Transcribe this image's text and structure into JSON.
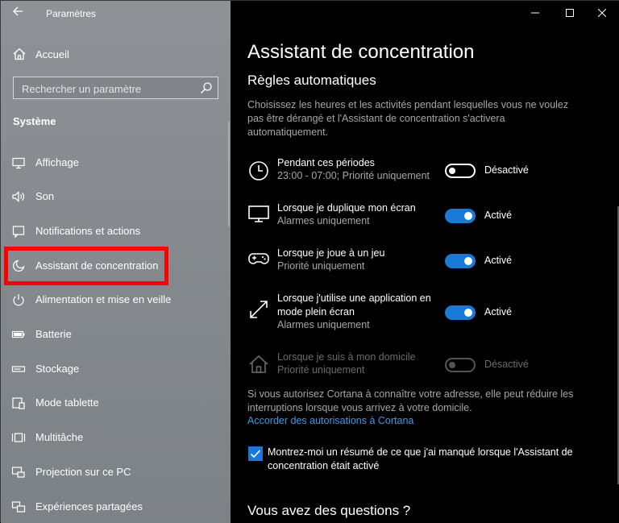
{
  "window": {
    "app_title": "Paramètres"
  },
  "sidebar": {
    "home_label": "Accueil",
    "search_placeholder": "Rechercher un paramètre",
    "section_title": "Système",
    "items": [
      {
        "label": "Affichage",
        "icon": "monitor-icon"
      },
      {
        "label": "Son",
        "icon": "speaker-icon"
      },
      {
        "label": "Notifications et actions",
        "icon": "notification-icon"
      },
      {
        "label": "Assistant de concentration",
        "icon": "moon-icon"
      },
      {
        "label": "Alimentation et mise en veille",
        "icon": "power-icon"
      },
      {
        "label": "Batterie",
        "icon": "battery-icon"
      },
      {
        "label": "Stockage",
        "icon": "storage-icon"
      },
      {
        "label": "Mode tablette",
        "icon": "tablet-icon"
      },
      {
        "label": "Multitâche",
        "icon": "multitask-icon"
      },
      {
        "label": "Projection sur ce PC",
        "icon": "projection-icon"
      },
      {
        "label": "Expériences partagées",
        "icon": "shared-icon"
      }
    ],
    "selected_index": 3
  },
  "main": {
    "title": "Assistant de concentration",
    "subheading": "Règles automatiques",
    "description": "Choisissez les heures et les activités pendant lesquelles vous ne voulez pas être dérangé et l'Assistant de concentration s'activera automatiquement.",
    "rules": [
      {
        "title": "Pendant ces périodes",
        "subtitle": "23:00 - 07:00; Priorité uniquement",
        "state": "Désactivé",
        "on": false,
        "enabled": true,
        "icon": "clock-icon"
      },
      {
        "title": "Lorsque je duplique mon écran",
        "subtitle": "Alarmes uniquement",
        "state": "Activé",
        "on": true,
        "enabled": true,
        "icon": "monitor-icon"
      },
      {
        "title": "Lorsque je joue à un jeu",
        "subtitle": "Priorité uniquement",
        "state": "Activé",
        "on": true,
        "enabled": true,
        "icon": "gamepad-icon"
      },
      {
        "title": "Lorsque j'utilise une application en mode plein écran",
        "subtitle": "Alarmes uniquement",
        "state": "Activé",
        "on": true,
        "enabled": true,
        "icon": "fullscreen-icon"
      },
      {
        "title": "Lorsque je suis à mon domicile",
        "subtitle": "Priorité uniquement",
        "state": "Désactivé",
        "on": false,
        "enabled": false,
        "icon": "home-icon"
      }
    ],
    "cortana_text": "Si vous autorisez Cortana à connaître votre adresse, elle peut réduire les interruptions lorsque vous arrivez à votre domicile.",
    "cortana_link": "Accorder des autorisations à Cortana",
    "checkbox_label": "Montrez-moi un résumé de ce que j'ai manqué lorsque l'Assistant de concentration était activé",
    "checkbox_checked": true,
    "questions_heading": "Vous avez des questions ?"
  },
  "colors": {
    "accent": "#1979d6",
    "link": "#3f9ae6",
    "highlight": "#ff0000"
  }
}
